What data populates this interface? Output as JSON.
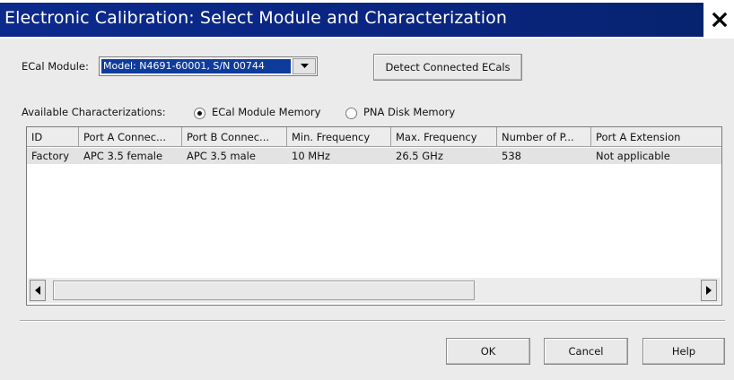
{
  "window": {
    "title": "Electronic Calibration: Select Module and Characterization"
  },
  "ecal_module": {
    "label": "ECal Module:",
    "selected": "Model: N4691-60001, S/N 00744"
  },
  "detect_button": "Detect Connected ECals",
  "characterizations": {
    "label": "Available Characterizations:",
    "options": [
      "ECal Module Memory",
      "PNA Disk Memory"
    ],
    "selected": "ECal Module Memory"
  },
  "table": {
    "columns": [
      "ID",
      "Port A Connec...",
      "Port B Connec...",
      "Min. Frequency",
      "Max. Frequency",
      "Number of P...",
      "Port A Extension"
    ],
    "rows": [
      [
        "Factory",
        "APC 3.5 female",
        "APC 3.5 male",
        "10 MHz",
        "26.5 GHz",
        "538",
        "Not applicable"
      ]
    ]
  },
  "buttons": {
    "ok": "OK",
    "cancel": "Cancel",
    "help": "Help"
  },
  "icons": {
    "close": "close-icon",
    "dropdown": "dropdown-arrow-icon",
    "scroll_left": "scroll-left-icon",
    "scroll_right": "scroll-right-icon"
  }
}
